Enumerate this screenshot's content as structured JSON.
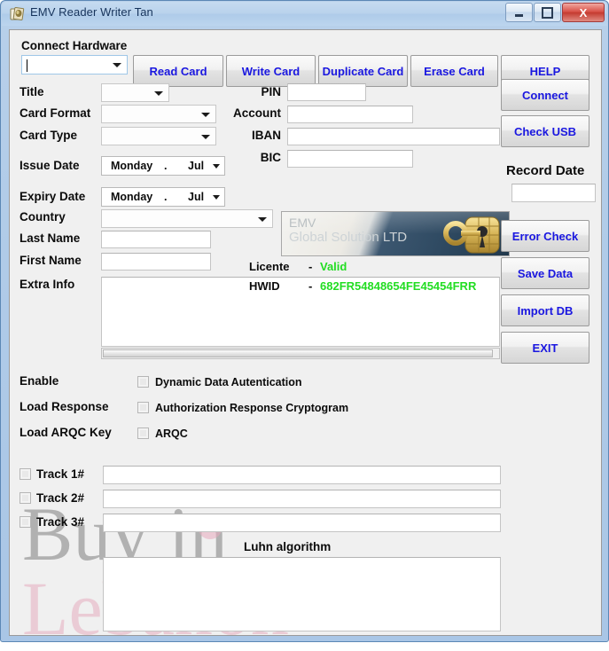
{
  "window": {
    "title": "EMV Reader Writer Tan",
    "icon": "cards-icon",
    "controls": {
      "minimize": "minimize-button",
      "maximize": "maximize-button",
      "close_label": "X"
    }
  },
  "toolbar": {
    "connect_hardware_label": "Connect Hardware",
    "connect_hardware_value": "",
    "buttons": [
      {
        "label": "Read Card"
      },
      {
        "label": "Write Card"
      },
      {
        "label": "Duplicate Card"
      },
      {
        "label": "Erase Card"
      },
      {
        "label": "HELP"
      }
    ]
  },
  "form": {
    "left_labels": {
      "title": "Title",
      "card_format": "Card Format",
      "card_type": "Card Type",
      "issue_date": "Issue Date",
      "expiry_date": "Expiry Date",
      "country": "Country",
      "last_name": "Last Name",
      "first_name": "First Name",
      "extra_info": "Extra Info"
    },
    "left_values": {
      "title": "",
      "card_format": "",
      "card_type": "",
      "country": "",
      "last_name": "",
      "first_name": "",
      "extra_info": ""
    },
    "issue_date": {
      "day": "Monday",
      "sep": ".",
      "month": "Jul"
    },
    "expiry_date": {
      "day": "Monday",
      "sep": ".",
      "month": "Jul"
    },
    "right_labels": {
      "pin": "PIN",
      "account": "Account",
      "iban": "IBAN",
      "bic": "BIC"
    },
    "right_values": {
      "pin": "",
      "account": "",
      "iban": "",
      "bic": ""
    }
  },
  "card_image": {
    "line1": "EMV",
    "line2": "Global Solution LTD",
    "icon": "gold-key-chip-icon"
  },
  "license": {
    "licente_label": "Licente",
    "licente_sep": "-",
    "licente_value": "Valid",
    "hwid_label": "HWID",
    "hwid_sep": "-",
    "hwid_value": "682FR54848654FE45454FRR",
    "valid_color": "#22dd22"
  },
  "side": {
    "connect": "Connect",
    "check_usb": "Check USB",
    "record_date_label": "Record Date",
    "record_date_value": "",
    "error_check": "Error Check",
    "save_data": "Save Data",
    "import_db": "Import DB",
    "exit": "EXIT"
  },
  "options": [
    {
      "row_label": "Enable",
      "checkbox_label": "Dynamic Data Autentication",
      "checked": false
    },
    {
      "row_label": "Load Response",
      "checkbox_label": "Authorization Response Cryptogram",
      "checked": false
    },
    {
      "row_label": "Load ARQC Key",
      "checkbox_label": "ARQC",
      "checked": false
    }
  ],
  "tracks": [
    {
      "label": "Track 1#",
      "value": "",
      "checked": false
    },
    {
      "label": "Track 2#",
      "value": "",
      "checked": false
    },
    {
      "label": "Track 3#",
      "value": "",
      "checked": false
    }
  ],
  "luhn": {
    "label": "Luhn algorithm",
    "value": ""
  },
  "watermark": {
    "line1": "Buy in",
    "line2": "Lebanon"
  }
}
